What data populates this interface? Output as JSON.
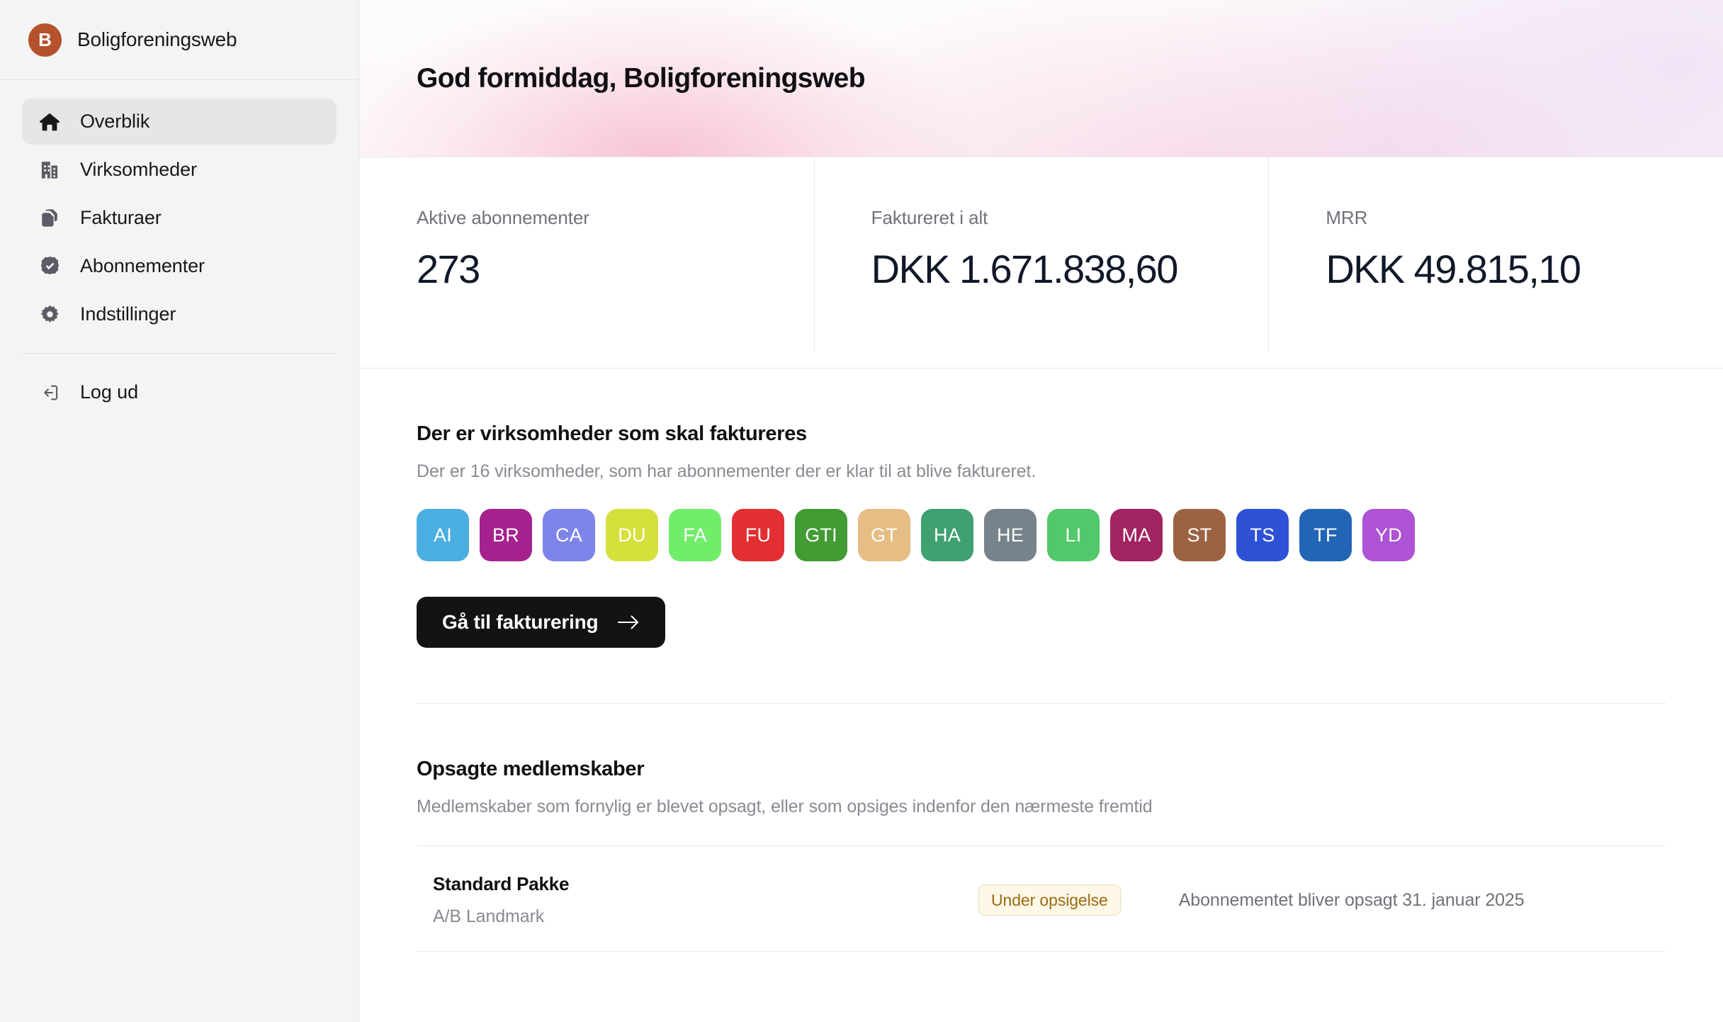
{
  "sidebar": {
    "brand": {
      "logo_letter": "B",
      "logo_color": "#b5512c",
      "name": "Boligforeningsweb"
    },
    "items": [
      {
        "label": "Overblik",
        "icon": "home-icon",
        "active": true
      },
      {
        "label": "Virksomheder",
        "icon": "buildings-icon",
        "active": false
      },
      {
        "label": "Fakturaer",
        "icon": "documents-icon",
        "active": false
      },
      {
        "label": "Abonnementer",
        "icon": "verified-badge-icon",
        "active": false
      },
      {
        "label": "Indstillinger",
        "icon": "gear-icon",
        "active": false
      }
    ],
    "logout": {
      "label": "Log ud",
      "icon": "logout-icon"
    }
  },
  "hero": {
    "greeting": "God formiddag, Boligforeningsweb"
  },
  "stats": [
    {
      "label": "Aktive abonnementer",
      "value": "273"
    },
    {
      "label": "Faktureret i alt",
      "value": "DKK 1.671.838,60"
    },
    {
      "label": "MRR",
      "value": "DKK 49.815,10"
    }
  ],
  "invoicing": {
    "title": "Der er virksomheder som skal faktureres",
    "subtitle": "Der er 16 virksomheder, som har abonnementer der er klar til at blive faktureret.",
    "companies": [
      {
        "initials": "AI",
        "color": "#4aaee0"
      },
      {
        "initials": "BR",
        "color": "#a5228e"
      },
      {
        "initials": "CA",
        "color": "#7d85ea"
      },
      {
        "initials": "DU",
        "color": "#d6e03c"
      },
      {
        "initials": "FA",
        "color": "#72ed6b"
      },
      {
        "initials": "FU",
        "color": "#e12f33"
      },
      {
        "initials": "GTI",
        "color": "#429b33"
      },
      {
        "initials": "GT",
        "color": "#e6bd84"
      },
      {
        "initials": "HA",
        "color": "#3fa172"
      },
      {
        "initials": "HE",
        "color": "#77838b"
      },
      {
        "initials": "LI",
        "color": "#52c86a"
      },
      {
        "initials": "MA",
        "color": "#a12461"
      },
      {
        "initials": "ST",
        "color": "#9c6343"
      },
      {
        "initials": "TS",
        "color": "#2f51d6"
      },
      {
        "initials": "TF",
        "color": "#2265b5"
      },
      {
        "initials": "YD",
        "color": "#ad53d4"
      }
    ],
    "cta_label": "Gå til fakturering",
    "cta_icon": "arrow-right-icon"
  },
  "cancellations": {
    "title": "Opsagte medlemskaber",
    "subtitle": "Medlemskaber som fornylig er blevet opsagt, eller som opsiges indenfor den nærmeste fremtid",
    "rows": [
      {
        "plan": "Standard Pakke",
        "company": "A/B Landmark",
        "status": "Under opsigelse",
        "note": "Abonnementet bliver opsagt 31. januar 2025"
      }
    ]
  }
}
